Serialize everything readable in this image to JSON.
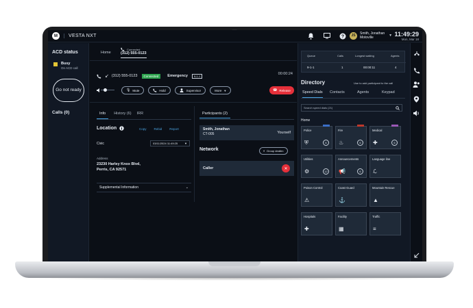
{
  "app": {
    "logo_letter": "M",
    "brand": "VESTA NXT"
  },
  "header": {
    "user_initials": "JS",
    "user_name": "Smith, Jonathan",
    "user_location": "Motoville",
    "time": "11:49:29",
    "date": "Mon, Mar 18",
    "icons": [
      "bell-icon",
      "monitor-icon",
      "help-icon"
    ]
  },
  "leftrail": {
    "acd_title": "ACD status",
    "status_label": "Busy",
    "status_sub": "On ACD call",
    "status_color": "#e3c535",
    "not_ready_label": "Go not ready",
    "calls_label": "Calls (0)"
  },
  "call_tabs": {
    "home": "Home",
    "call_status": "Connected",
    "call_number": "(312) 555-0123"
  },
  "call_info": {
    "number": "(312) 555-0123",
    "state_badge": "Connected",
    "type": "Emergency",
    "line_badge": "9-1-1",
    "timer": "00:00:24"
  },
  "controls": {
    "mute": "Mute",
    "hold": "Hold",
    "supervisor": "Supervisor",
    "more": "More",
    "release": "Release",
    "release_color": "#e5303a"
  },
  "info_tabs": {
    "info": "Info",
    "history": "History (6)",
    "irr": "IRR"
  },
  "location": {
    "title": "Location",
    "copy": "Copy",
    "rebid": "Rebid",
    "report": "Report",
    "civic_label": "Civic",
    "datetime": "03/11/2024 11:49:25",
    "address_label": "Address",
    "address_line1": "23230 Harley Knox Blvd,",
    "address_line2": "Perris, CA 92571",
    "supplemental": "Supplemental Information"
  },
  "participants": {
    "tab_label": "Participants (2)",
    "name": "Smith, Jonathan",
    "position": "CT-005",
    "self_label": "Yourself",
    "network_title": "Network",
    "group_deafen": "Group deafen",
    "caller_label": "Caller"
  },
  "queue": {
    "headers": [
      "Queue",
      "Calls",
      "Longest waiting",
      "Agents"
    ],
    "rows": [
      [
        "9-1-1",
        "1",
        "00:00:11",
        "4"
      ]
    ]
  },
  "directory": {
    "title": "Directory",
    "hint": "Use to add participant to the call",
    "tabs": [
      "Speed Dials",
      "Contacts",
      "Agents",
      "Keypad"
    ],
    "search_placeholder": "Search speed dials (21)",
    "home_label": "Home",
    "tiles": [
      {
        "label": "Police",
        "count": "6",
        "icon": "shield-icon",
        "tag_color": "#3b6fc7"
      },
      {
        "label": "Fire",
        "count": "6",
        "icon": "fire-icon",
        "tag_color": "#c0392b"
      },
      {
        "label": "Medical",
        "count": "6",
        "icon": "medical-icon",
        "tag_color": "#9b59b6"
      },
      {
        "label": "Utilities",
        "count": "12",
        "icon": "utilities-icon",
        "tag_color": ""
      },
      {
        "label": "Announcements",
        "count": "6",
        "icon": "megaphone-icon",
        "tag_color": ""
      },
      {
        "label": "Language line",
        "count": "",
        "icon": "language-icon",
        "tag_color": ""
      },
      {
        "label": "Poison Control",
        "count": "",
        "icon": "hazard-icon",
        "tag_color": ""
      },
      {
        "label": "Coast Guard",
        "count": "",
        "icon": "anchor-icon",
        "tag_color": ""
      },
      {
        "label": "Mountain Rescue",
        "count": "",
        "icon": "mountain-icon",
        "tag_color": ""
      },
      {
        "label": "Hospitals",
        "count": "",
        "icon": "cross-icon",
        "tag_color": ""
      },
      {
        "label": "Facility",
        "count": "",
        "icon": "facility-icon",
        "tag_color": ""
      },
      {
        "label": "Traffic",
        "count": "",
        "icon": "traffic-icon",
        "tag_color": ""
      }
    ]
  },
  "rightrail": {
    "icons": [
      "phone-transfer-icon",
      "phone-hangup-icon",
      "users-icon",
      "map-pin-icon",
      "speaker-icon",
      "collapse-icon"
    ]
  }
}
